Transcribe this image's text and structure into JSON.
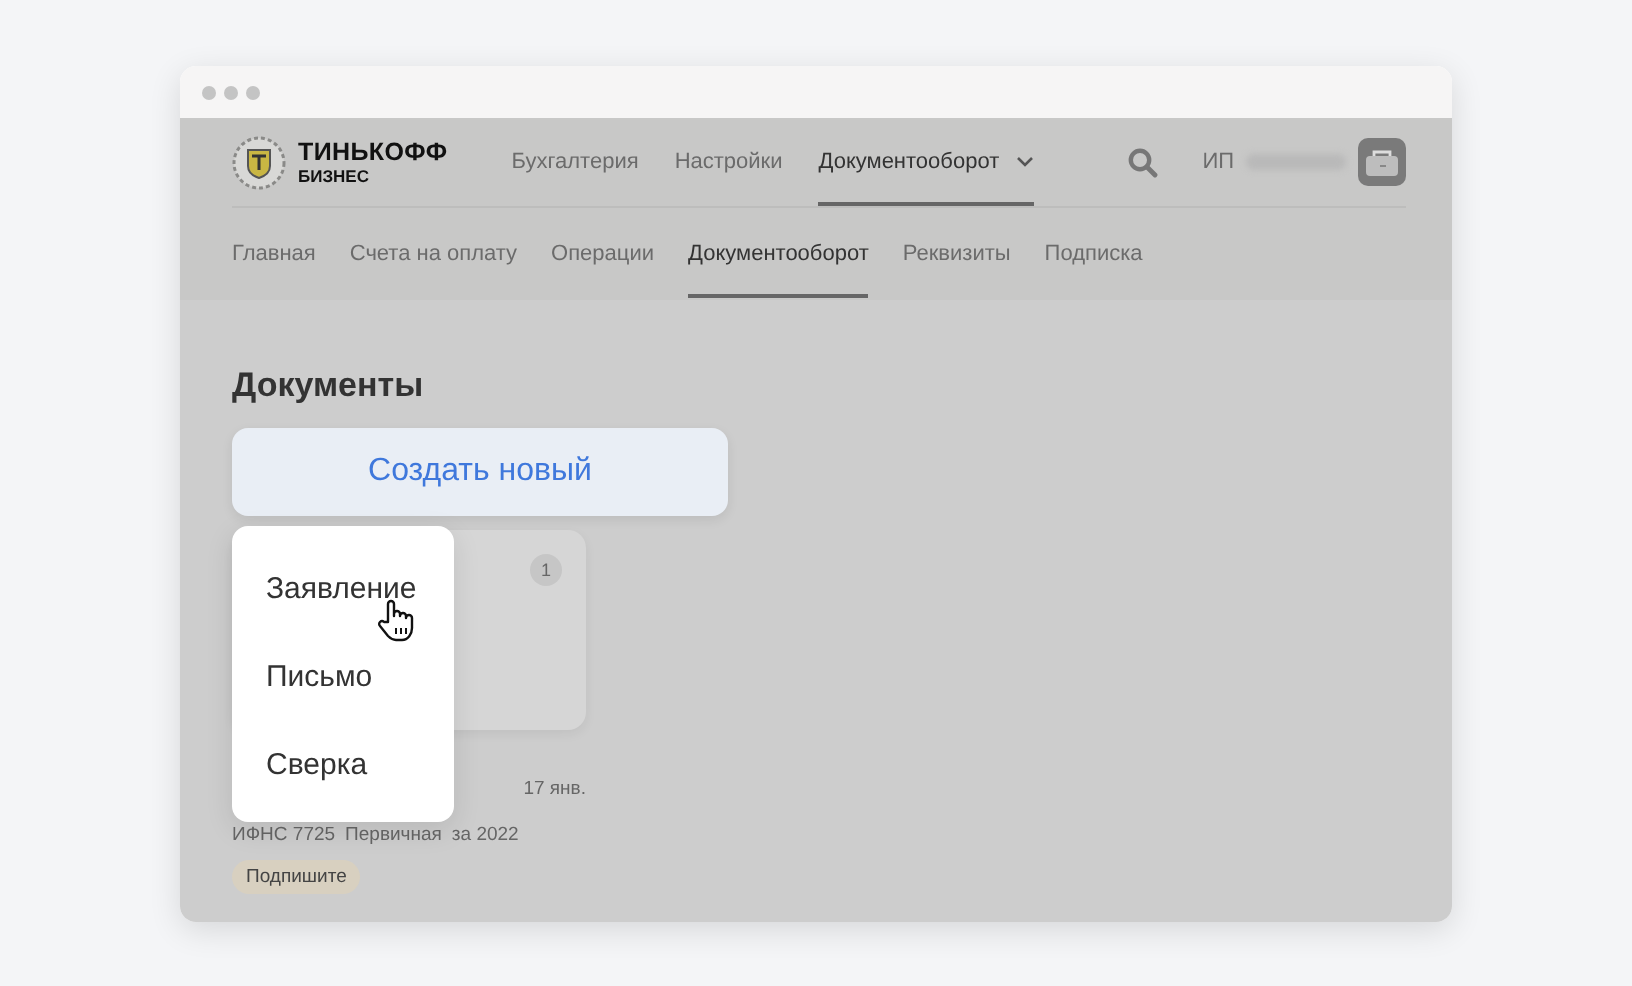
{
  "header": {
    "logo": {
      "title": "ТИНЬКОФФ",
      "subtitle": "БИЗНЕС"
    },
    "nav": [
      {
        "label": "Бухгалтерия",
        "selected": false,
        "dropdown": false
      },
      {
        "label": "Настройки",
        "selected": false,
        "dropdown": false
      },
      {
        "label": "Документооборот",
        "selected": true,
        "dropdown": true
      }
    ],
    "account": {
      "prefix": "ИП"
    }
  },
  "subnav": [
    {
      "label": "Главная",
      "selected": false
    },
    {
      "label": "Счета на оплату",
      "selected": false
    },
    {
      "label": "Операции",
      "selected": false
    },
    {
      "label": "Документооборот",
      "selected": true
    },
    {
      "label": "Реквизиты",
      "selected": false
    },
    {
      "label": "Подписка",
      "selected": false
    }
  ],
  "page": {
    "title": "Документы",
    "create_button": "Создать новый",
    "menu": [
      {
        "label": "Заявление",
        "hovered": true
      },
      {
        "label": "Письмо",
        "hovered": false
      },
      {
        "label": "Сверка",
        "hovered": false
      }
    ],
    "document": {
      "count": "1",
      "date": "17 янв.",
      "meta": [
        "ИФНС 7725",
        "Первичная",
        "за 2022"
      ],
      "status": "Подпишите"
    }
  }
}
